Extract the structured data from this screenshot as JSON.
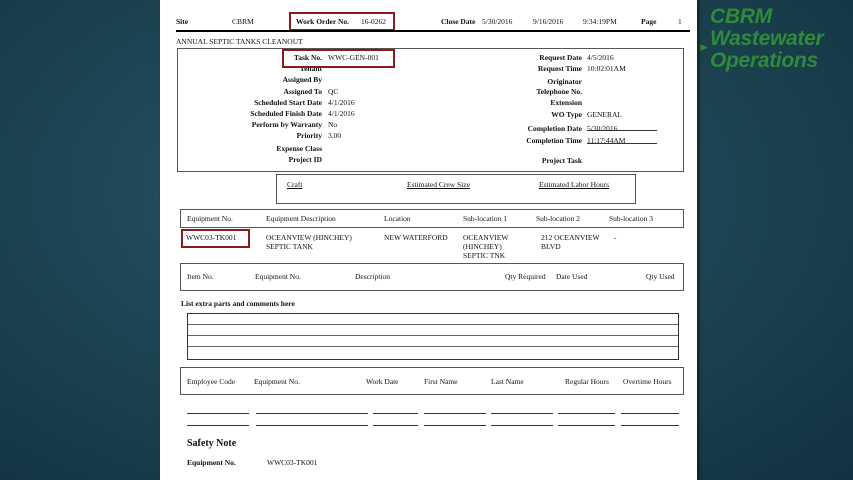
{
  "logo": {
    "line1": "CBRM",
    "line2": "Wastewater",
    "line3": "Operations"
  },
  "header": {
    "site_label": "Site",
    "site_value": "CBRM",
    "wo_label": "Work Order No.",
    "wo_value": "16-0262",
    "close_label": "Close Date",
    "close_value": "5/30/2016",
    "date": "9/16/2016",
    "time": "9:34:19PM",
    "page_label": "Page",
    "page_value": "1"
  },
  "subtitle": "ANNUAL SEPTIC TANKS CLEANOUT",
  "task": {
    "left_labels": [
      "Task No.",
      "Tenant",
      "Assigned By",
      "Assigned To",
      "Scheduled Start Date",
      "Scheduled Finish Date",
      "Perform by Warranty",
      "Priority",
      "Expense Class",
      "Project ID"
    ],
    "left_values": [
      "WWC-GEN-001",
      "",
      "",
      "QC",
      "4/1/2016",
      "4/1/2016",
      "No",
      "3.00",
      "",
      ""
    ],
    "right_labels": [
      "Request Date",
      "Request Time",
      "Originator",
      "Telephone No.",
      "Extension",
      "WO Type",
      "Completion Date",
      "Completion Time",
      "Project Task"
    ],
    "right_values": [
      "4/5/2016",
      "10:02:01AM",
      "",
      "",
      "",
      "GENERAL",
      "5/30/2016",
      "11:17:44AM",
      ""
    ]
  },
  "craft": {
    "headers": [
      "Craft",
      "Estimated Crew Size",
      "Estimated Labor Hours"
    ]
  },
  "equipment": {
    "headers": [
      "Equipment No.",
      "Equipment Description",
      "Location",
      "Sub-location 1",
      "Sub-location 2",
      "Sub-location 3"
    ],
    "row": {
      "no": "WWC03-TK001",
      "desc1": "OCEANVIEW (HINCHEY)",
      "desc2": "SEPTIC TANK",
      "loc": "NEW WATERFORD",
      "sub1a": "OCEANVIEW",
      "sub1b": "(HINCHEY)",
      "sub1c": "SEPTIC TNK",
      "sub2a": "212 OCEANVIEW",
      "sub2b": "BLVD",
      "sub3": "-"
    }
  },
  "items": {
    "headers": [
      "Item No.",
      "Equipment No.",
      "Description",
      "Qty Required",
      "Date Used",
      "Qty Used"
    ]
  },
  "extra_parts": "List extra parts and comments here",
  "labor": {
    "headers": [
      "Employee Code",
      "Equipment No.",
      "Work Date",
      "First Name",
      "Last Name",
      "Regular Hours",
      "Overtime Hours"
    ]
  },
  "safety": {
    "title": "Safety Note",
    "label": "Equipment No.",
    "value": "WWC03-TK001"
  }
}
